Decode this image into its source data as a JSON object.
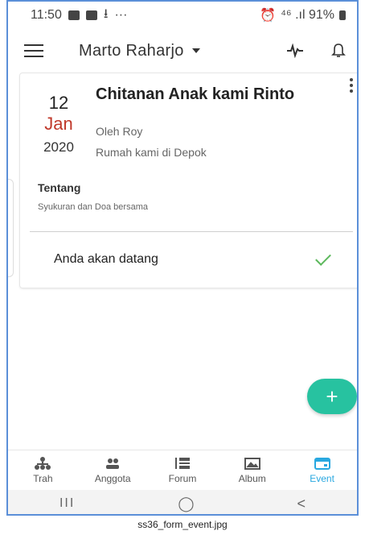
{
  "status": {
    "time": "11:50",
    "dots": "···",
    "right_text": "⁴⁶ .ıl 91%"
  },
  "appbar": {
    "title": "Marto Raharjo"
  },
  "event": {
    "day": "12",
    "month": "Jan",
    "year": "2020",
    "title": "Chitanan Anak kami Rinto",
    "by": "Oleh Roy",
    "location": "Rumah kami di Depok",
    "about_label": "Tentang",
    "about_text": "Syukuran dan Doa bersama",
    "rsvp_label": "Anda akan datang"
  },
  "fab": {
    "label": "+"
  },
  "nav": {
    "items": [
      {
        "label": "Trah"
      },
      {
        "label": "Anggota"
      },
      {
        "label": "Forum"
      },
      {
        "label": "Album"
      },
      {
        "label": "Event"
      }
    ]
  },
  "system_nav": {
    "recent": "III",
    "home": "◯",
    "back": "<"
  },
  "caption": "ss36_form_event.jpg",
  "colors": {
    "accent": "#27c2a0",
    "active_nav": "#29a8e0",
    "month": "#c0392b",
    "check": "#5cb85c"
  }
}
